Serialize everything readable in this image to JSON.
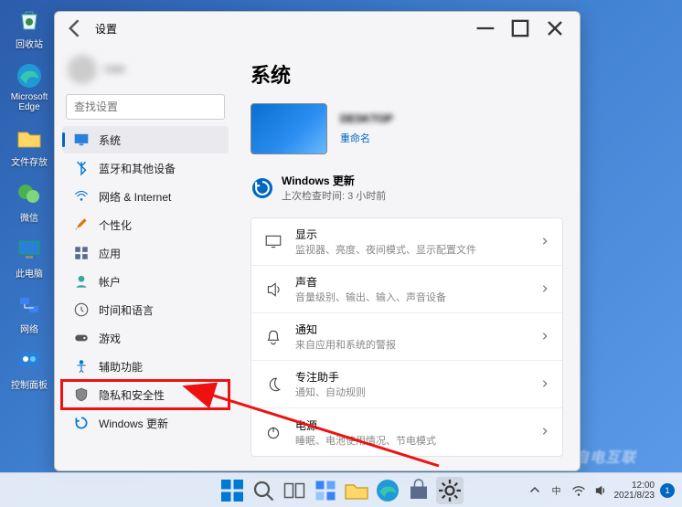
{
  "desktop": {
    "icons": [
      {
        "label": "回收站",
        "icon": "recycle"
      },
      {
        "label": "Microsoft Edge",
        "icon": "edge"
      },
      {
        "label": "文件存放",
        "icon": "folder"
      },
      {
        "label": "微信",
        "icon": "wechat"
      },
      {
        "label": "此电脑",
        "icon": "pc"
      },
      {
        "label": "网络",
        "icon": "network"
      },
      {
        "label": "控制面板",
        "icon": "control"
      }
    ]
  },
  "window": {
    "title": "设置",
    "search_placeholder": "查找设置"
  },
  "sidebar": {
    "items": [
      {
        "label": "系统",
        "icon": "system",
        "active": true
      },
      {
        "label": "蓝牙和其他设备",
        "icon": "bluetooth"
      },
      {
        "label": "网络 & Internet",
        "icon": "wifi"
      },
      {
        "label": "个性化",
        "icon": "brush"
      },
      {
        "label": "应用",
        "icon": "apps"
      },
      {
        "label": "帐户",
        "icon": "account"
      },
      {
        "label": "时间和语言",
        "icon": "time"
      },
      {
        "label": "游戏",
        "icon": "gaming"
      },
      {
        "label": "辅助功能",
        "icon": "accessibility"
      },
      {
        "label": "隐私和安全性",
        "icon": "privacy",
        "highlighted": true
      },
      {
        "label": "Windows 更新",
        "icon": "update"
      }
    ]
  },
  "content": {
    "heading": "系统",
    "device_name": "DESKTOP",
    "rename_label": "重命名",
    "update_title": "Windows 更新",
    "update_sub": "上次检查时间: 3 小时前",
    "rows": [
      {
        "title": "显示",
        "sub": "监视器、亮度、夜间模式、显示配置文件",
        "icon": "display"
      },
      {
        "title": "声音",
        "sub": "音量级别、输出、输入、声音设备",
        "icon": "sound"
      },
      {
        "title": "通知",
        "sub": "来自应用和系统的警报",
        "icon": "bell"
      },
      {
        "title": "专注助手",
        "sub": "通知、自动规则",
        "icon": "moon"
      },
      {
        "title": "电源",
        "sub": "睡眠、电池使用情况、节电模式",
        "icon": "power"
      }
    ]
  },
  "taskbar": {
    "time": "12:00",
    "date": "2021/8/23",
    "notification_count": "1"
  },
  "watermark": "自电互联"
}
